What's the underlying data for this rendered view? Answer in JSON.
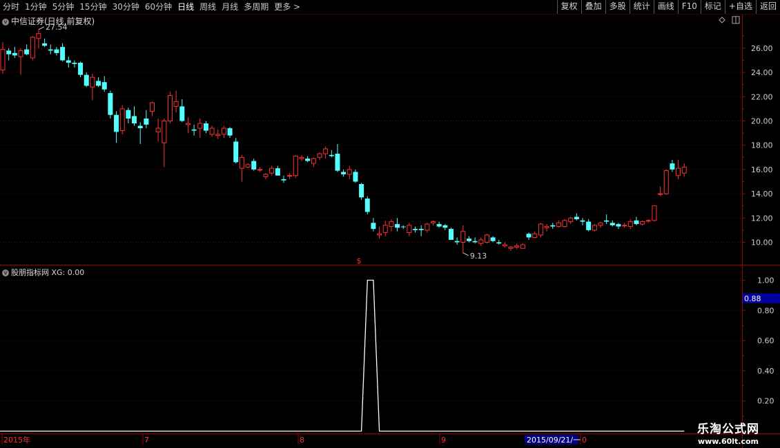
{
  "toolbar": {
    "left": [
      "分时",
      "1分钟",
      "5分钟",
      "15分钟",
      "30分钟",
      "60分钟",
      "日线",
      "周线",
      "月线",
      "多周期",
      "更多 >"
    ],
    "active_index": 6,
    "right": [
      "复权",
      "叠加",
      "多股",
      "统计",
      "画线",
      "F10",
      "标记",
      "+自选",
      "返回"
    ]
  },
  "main_panel": {
    "title": "中信证券(日线,前复权)",
    "high_label": "27.54",
    "low_label": "9.13",
    "marker": "$",
    "y_ticks": [
      "26.00",
      "24.00",
      "22.00",
      "20.00",
      "18.00",
      "16.00",
      "14.00",
      "12.00",
      "10.00"
    ]
  },
  "indicator_panel": {
    "title": "股朋指标网 XG: 0.00",
    "y_ticks": [
      "1.00",
      "0.80",
      "0.60",
      "0.40",
      "0.20"
    ],
    "current_value": "0.88"
  },
  "x_axis": {
    "labels": [
      "2015年",
      "7",
      "8",
      "9",
      "0"
    ],
    "cursor_date": "2015/09/21/一"
  },
  "watermark": {
    "title": "乐淘公式网",
    "url": "www.60lt.com"
  },
  "colors": {
    "up": "#ff3232",
    "down": "#54ffff",
    "grid": "#7a0000",
    "axis": "#a00000",
    "signal": "#ffffff"
  },
  "chart_data": [
    {
      "type": "candlestick",
      "title": "中信证券(日线,前复权)",
      "ohlc": [
        [
          24.2,
          26.5,
          23.9,
          25.9
        ],
        [
          25.8,
          26.0,
          25.0,
          25.5
        ],
        [
          25.6,
          26.1,
          25.2,
          25.4
        ],
        [
          25.3,
          26.0,
          23.8,
          25.8
        ],
        [
          25.9,
          26.3,
          25.4,
          25.5
        ],
        [
          25.2,
          27.0,
          25.0,
          26.9
        ],
        [
          26.8,
          27.54,
          26.0,
          27.2
        ],
        [
          26.4,
          26.8,
          26.1,
          26.2
        ],
        [
          25.9,
          26.3,
          25.5,
          25.8
        ],
        [
          25.9,
          26.1,
          25.4,
          25.6
        ],
        [
          26.1,
          26.4,
          24.9,
          25.0
        ],
        [
          25.0,
          25.3,
          24.4,
          24.8
        ],
        [
          24.8,
          25.0,
          24.4,
          24.7
        ],
        [
          24.8,
          24.9,
          23.6,
          23.8
        ],
        [
          23.8,
          24.0,
          22.8,
          22.9
        ],
        [
          22.8,
          23.9,
          21.7,
          23.6
        ],
        [
          23.3,
          23.6,
          22.8,
          22.9
        ],
        [
          23.2,
          23.7,
          22.4,
          22.6
        ],
        [
          22.3,
          22.5,
          20.2,
          20.5
        ],
        [
          20.5,
          20.8,
          18.2,
          19.1
        ],
        [
          19.2,
          21.3,
          18.9,
          21.0
        ],
        [
          20.9,
          21.1,
          19.8,
          20.2
        ],
        [
          20.4,
          21.2,
          19.6,
          19.8
        ],
        [
          19.6,
          19.9,
          18.1,
          19.4
        ],
        [
          20.2,
          20.9,
          19.4,
          19.7
        ],
        [
          20.8,
          21.6,
          20.4,
          21.5
        ],
        [
          19.1,
          20.2,
          18.3,
          19.4
        ],
        [
          18.2,
          20.2,
          16.2,
          20.0
        ],
        [
          20.0,
          22.4,
          19.8,
          22.1
        ],
        [
          21.2,
          22.5,
          20.7,
          21.6
        ],
        [
          21.2,
          21.8,
          19.9,
          20.0
        ],
        [
          19.7,
          20.3,
          19.0,
          19.8
        ],
        [
          19.3,
          19.7,
          18.8,
          19.2
        ],
        [
          19.4,
          20.2,
          18.6,
          19.8
        ],
        [
          19.8,
          20.0,
          19.0,
          19.2
        ],
        [
          18.9,
          19.6,
          18.7,
          19.4
        ],
        [
          18.8,
          19.3,
          18.5,
          18.9
        ],
        [
          18.9,
          19.6,
          18.6,
          19.4
        ],
        [
          19.4,
          19.5,
          18.6,
          18.8
        ],
        [
          18.3,
          18.6,
          16.5,
          16.6
        ],
        [
          16.1,
          17.2,
          15.0,
          17.0
        ],
        [
          16.2,
          16.5,
          16.1,
          16.4
        ],
        [
          16.7,
          16.9,
          15.9,
          16.0
        ],
        [
          16.0,
          16.2,
          15.8,
          16.0
        ],
        [
          15.4,
          15.7,
          15.2,
          15.6
        ],
        [
          15.7,
          16.3,
          15.5,
          16.1
        ],
        [
          16.1,
          16.3,
          15.5,
          15.5
        ],
        [
          15.2,
          15.5,
          14.9,
          15.1
        ],
        [
          15.5,
          15.7,
          15.2,
          15.5
        ],
        [
          15.5,
          17.2,
          15.3,
          17.1
        ],
        [
          16.9,
          17.2,
          16.7,
          17.0
        ],
        [
          16.9,
          17.1,
          16.6,
          16.7
        ],
        [
          16.5,
          17.0,
          16.2,
          16.9
        ],
        [
          17.0,
          17.4,
          16.8,
          17.3
        ],
        [
          17.3,
          17.9,
          16.9,
          17.7
        ],
        [
          17.2,
          17.6,
          17.0,
          17.1
        ],
        [
          17.3,
          18.1,
          15.8,
          15.9
        ],
        [
          15.8,
          16.0,
          15.4,
          15.6
        ],
        [
          15.6,
          16.3,
          15.2,
          16.0
        ],
        [
          15.8,
          16.0,
          14.9,
          15.0
        ],
        [
          14.8,
          14.9,
          13.5,
          13.7
        ],
        [
          13.6,
          13.8,
          12.3,
          12.5
        ],
        [
          11.6,
          12.0,
          10.9,
          11.1
        ],
        [
          10.6,
          11.3,
          10.3,
          10.7
        ],
        [
          10.8,
          11.8,
          10.5,
          11.4
        ],
        [
          11.3,
          11.9,
          10.9,
          11.7
        ],
        [
          11.5,
          12.0,
          10.9,
          11.2
        ],
        [
          11.3,
          11.4,
          11.1,
          11.25
        ],
        [
          10.8,
          11.6,
          10.5,
          11.4
        ],
        [
          11.1,
          11.3,
          10.8,
          11.0
        ],
        [
          11.1,
          11.4,
          10.5,
          11.0
        ],
        [
          11.0,
          11.6,
          10.8,
          11.5
        ],
        [
          11.6,
          11.8,
          11.4,
          11.7
        ],
        [
          11.5,
          11.7,
          11.2,
          11.3
        ],
        [
          11.4,
          11.5,
          11.0,
          11.2
        ],
        [
          11.1,
          11.2,
          10.2,
          10.2
        ],
        [
          10.1,
          10.4,
          9.8,
          10.0
        ],
        [
          10.0,
          11.4,
          9.13,
          10.9
        ],
        [
          10.3,
          10.5,
          10.0,
          10.1
        ],
        [
          10.1,
          10.4,
          9.9,
          10.0
        ],
        [
          9.9,
          10.4,
          9.7,
          10.2
        ],
        [
          10.0,
          10.7,
          9.9,
          10.6
        ],
        [
          10.4,
          10.5,
          10.0,
          10.1
        ],
        [
          10.0,
          10.2,
          9.8,
          9.9
        ],
        [
          9.7,
          10.0,
          9.6,
          9.8
        ],
        [
          9.5,
          9.7,
          9.3,
          9.6
        ],
        [
          9.6,
          9.9,
          9.4,
          9.7
        ],
        [
          9.5,
          9.9,
          9.5,
          9.8
        ],
        [
          10.7,
          10.8,
          10.2,
          10.4
        ],
        [
          10.4,
          10.9,
          10.3,
          10.7
        ],
        [
          10.6,
          11.6,
          10.4,
          11.5
        ],
        [
          11.2,
          11.5,
          10.9,
          11.3
        ],
        [
          11.4,
          11.6,
          11.1,
          11.3
        ],
        [
          11.3,
          11.8,
          11.2,
          11.6
        ],
        [
          11.3,
          11.9,
          11.2,
          11.8
        ],
        [
          11.7,
          12.1,
          11.5,
          12.0
        ],
        [
          12.1,
          12.4,
          11.8,
          11.9
        ],
        [
          11.8,
          12.0,
          11.4,
          11.7
        ],
        [
          11.7,
          11.9,
          10.9,
          11.0
        ],
        [
          11.0,
          11.5,
          10.9,
          11.4
        ],
        [
          11.4,
          11.7,
          11.2,
          11.6
        ],
        [
          11.8,
          12.3,
          11.5,
          11.7
        ],
        [
          11.6,
          11.8,
          11.3,
          11.4
        ],
        [
          11.5,
          11.6,
          11.1,
          11.3
        ],
        [
          11.4,
          11.6,
          11.2,
          11.4
        ],
        [
          11.3,
          11.9,
          11.1,
          11.7
        ],
        [
          11.8,
          12.1,
          11.4,
          11.5
        ],
        [
          11.5,
          11.8,
          11.4,
          11.7
        ],
        [
          11.8,
          11.9,
          11.6,
          11.8
        ],
        [
          11.8,
          13.0,
          11.7,
          13.0
        ],
        [
          14.0,
          14.6,
          13.8,
          14.0
        ],
        [
          14.0,
          16.0,
          13.9,
          15.9
        ],
        [
          16.5,
          16.8,
          15.8,
          16.0
        ],
        [
          15.5,
          16.8,
          15.2,
          16.1
        ],
        [
          15.7,
          16.5,
          15.4,
          16.2
        ]
      ]
    },
    {
      "type": "line",
      "title": "股朋指标网",
      "series": [
        {
          "name": "XG",
          "values": [
            0,
            0,
            0,
            0,
            0,
            0,
            0,
            0,
            0,
            0,
            0,
            0,
            0,
            0,
            0,
            0,
            0,
            0,
            0,
            0,
            0,
            0,
            0,
            0,
            0,
            0,
            0,
            0,
            0,
            0,
            0,
            0,
            0,
            0,
            0,
            0,
            0,
            0,
            0,
            0,
            0,
            0,
            0,
            0,
            0,
            0,
            0,
            0,
            0,
            0,
            0,
            0,
            0,
            0,
            0,
            0,
            0,
            0,
            0,
            0,
            0,
            1,
            1,
            0,
            0,
            0,
            0,
            0,
            0,
            0,
            0,
            0,
            0,
            0,
            0,
            0,
            0,
            0,
            0,
            0,
            0,
            0,
            0,
            0,
            0,
            0,
            0,
            0,
            0,
            0,
            0,
            0,
            0,
            0,
            0,
            0,
            0,
            0,
            0,
            0,
            0,
            0,
            0,
            0,
            0,
            0,
            0,
            0,
            0,
            0,
            0,
            0,
            0,
            0,
            0
          ]
        }
      ],
      "ylim": [
        0,
        1
      ]
    }
  ]
}
